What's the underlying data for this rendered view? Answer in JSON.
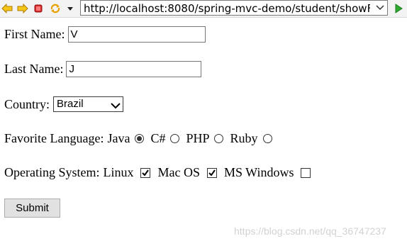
{
  "browser": {
    "url": "http://localhost:8080/spring-mvc-demo/student/showF",
    "buttons": [
      "back-icon",
      "forward-icon",
      "stop-icon",
      "refresh-icon",
      "dropdown-icon",
      "go-icon"
    ]
  },
  "form": {
    "first_name": {
      "label": "First Name:",
      "value": "V"
    },
    "last_name": {
      "label": "Last Name:",
      "value": "J"
    },
    "country": {
      "label": "Country:",
      "selected": "Brazil"
    },
    "favorite_language": {
      "label": "Favorite Language:",
      "options": [
        {
          "label": "Java",
          "checked": true
        },
        {
          "label": "C#",
          "checked": false
        },
        {
          "label": "PHP",
          "checked": false
        },
        {
          "label": "Ruby",
          "checked": false
        }
      ]
    },
    "operating_system": {
      "label": "Operating System:",
      "options": [
        {
          "label": "Linux",
          "checked": true
        },
        {
          "label": "Mac OS",
          "checked": true
        },
        {
          "label": "MS Windows",
          "checked": false
        }
      ]
    },
    "submit_label": "Submit"
  },
  "watermark": "https://blog.csdn.net/qq_36747237",
  "colors": {
    "back_arrow": "#f0b400",
    "forward_arrow": "#f0b400",
    "stop": "#d92a2a",
    "go": "#2faa2f"
  }
}
